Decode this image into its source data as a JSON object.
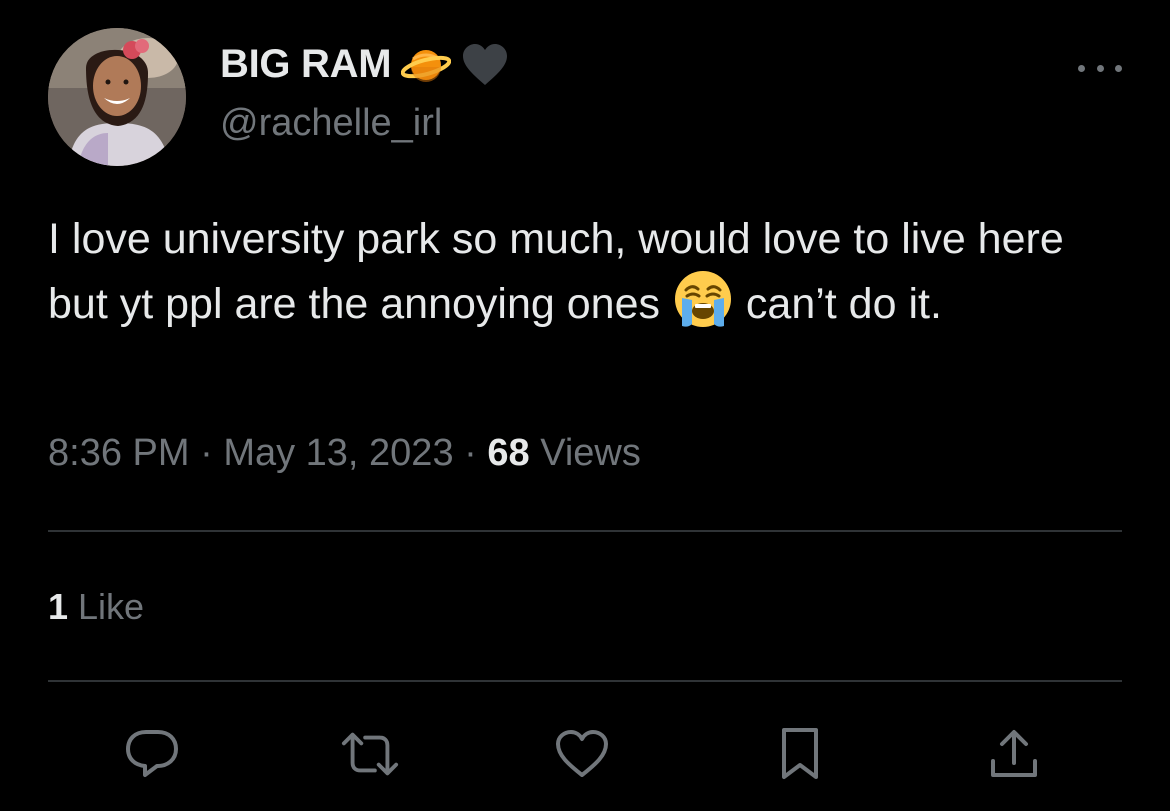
{
  "user": {
    "display_name": "BIG RAM",
    "name_emojis": [
      "ringed-planet-emoji",
      "black-heart-emoji"
    ],
    "handle": "@rachelle_irl",
    "avatar": "profile-photo"
  },
  "tweet": {
    "text_part1": "I love university park so much, would love to live here but yt ppl are the annoying ones ",
    "inline_emoji": "loudly-crying-face-emoji",
    "text_part2": " can’t do it."
  },
  "meta": {
    "time": "8:36 PM",
    "separator": " · ",
    "date": "May 13, 2023",
    "views_count": "68",
    "views_label": " Views"
  },
  "engagement": {
    "likes_count": "1",
    "likes_label": " Like"
  },
  "actions": [
    {
      "name": "reply",
      "icon": "reply-icon"
    },
    {
      "name": "retweet",
      "icon": "retweet-icon"
    },
    {
      "name": "like",
      "icon": "heart-icon"
    },
    {
      "name": "bookmark",
      "icon": "bookmark-icon"
    },
    {
      "name": "share",
      "icon": "share-icon"
    }
  ],
  "colors": {
    "background": "#000000",
    "primary_text": "#e7e9ea",
    "secondary_text": "#71767b",
    "divider": "#2f3336"
  }
}
